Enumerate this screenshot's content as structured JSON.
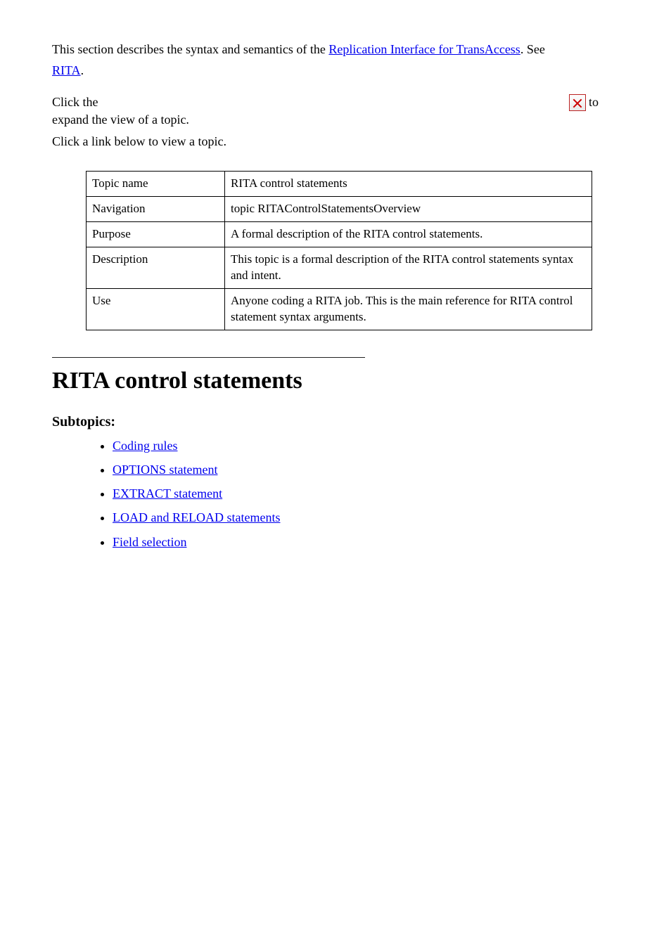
{
  "para1": {
    "prefix": "This section describes the syntax and semantics of the ",
    "link_text": "Replication Interface for TransAccess",
    "suffix": ". See ",
    "link2_text": "RITA",
    "suffix2": "."
  },
  "expand_line": {
    "prefix": "Click the ",
    "icon_alt": "broken-image-icon",
    "suffix1": " to expand the view of a topic.",
    "suffix_line2": "Click a link below to view a topic."
  },
  "topic_table": [
    {
      "k": "Topic name",
      "v": "RITA control statements"
    },
    {
      "k": "Navigation",
      "v": "topic RITAControlStatementsOverview"
    },
    {
      "k": "Purpose",
      "v": "A formal description of the RITA control statements."
    },
    {
      "k": "Description",
      "v": "This topic is a formal description of the RITA control statements syntax and intent."
    },
    {
      "k": "Use",
      "v": "Anyone coding a RITA job. This is the main reference for RITA control statement syntax arguments."
    }
  ],
  "heading_main": "RITA control statements",
  "heading_sub": "Subtopics:",
  "subtopics": [
    "Coding rules",
    "OPTIONS statement",
    "EXTRACT statement",
    "LOAD and RELOAD statements",
    "Field selection"
  ]
}
